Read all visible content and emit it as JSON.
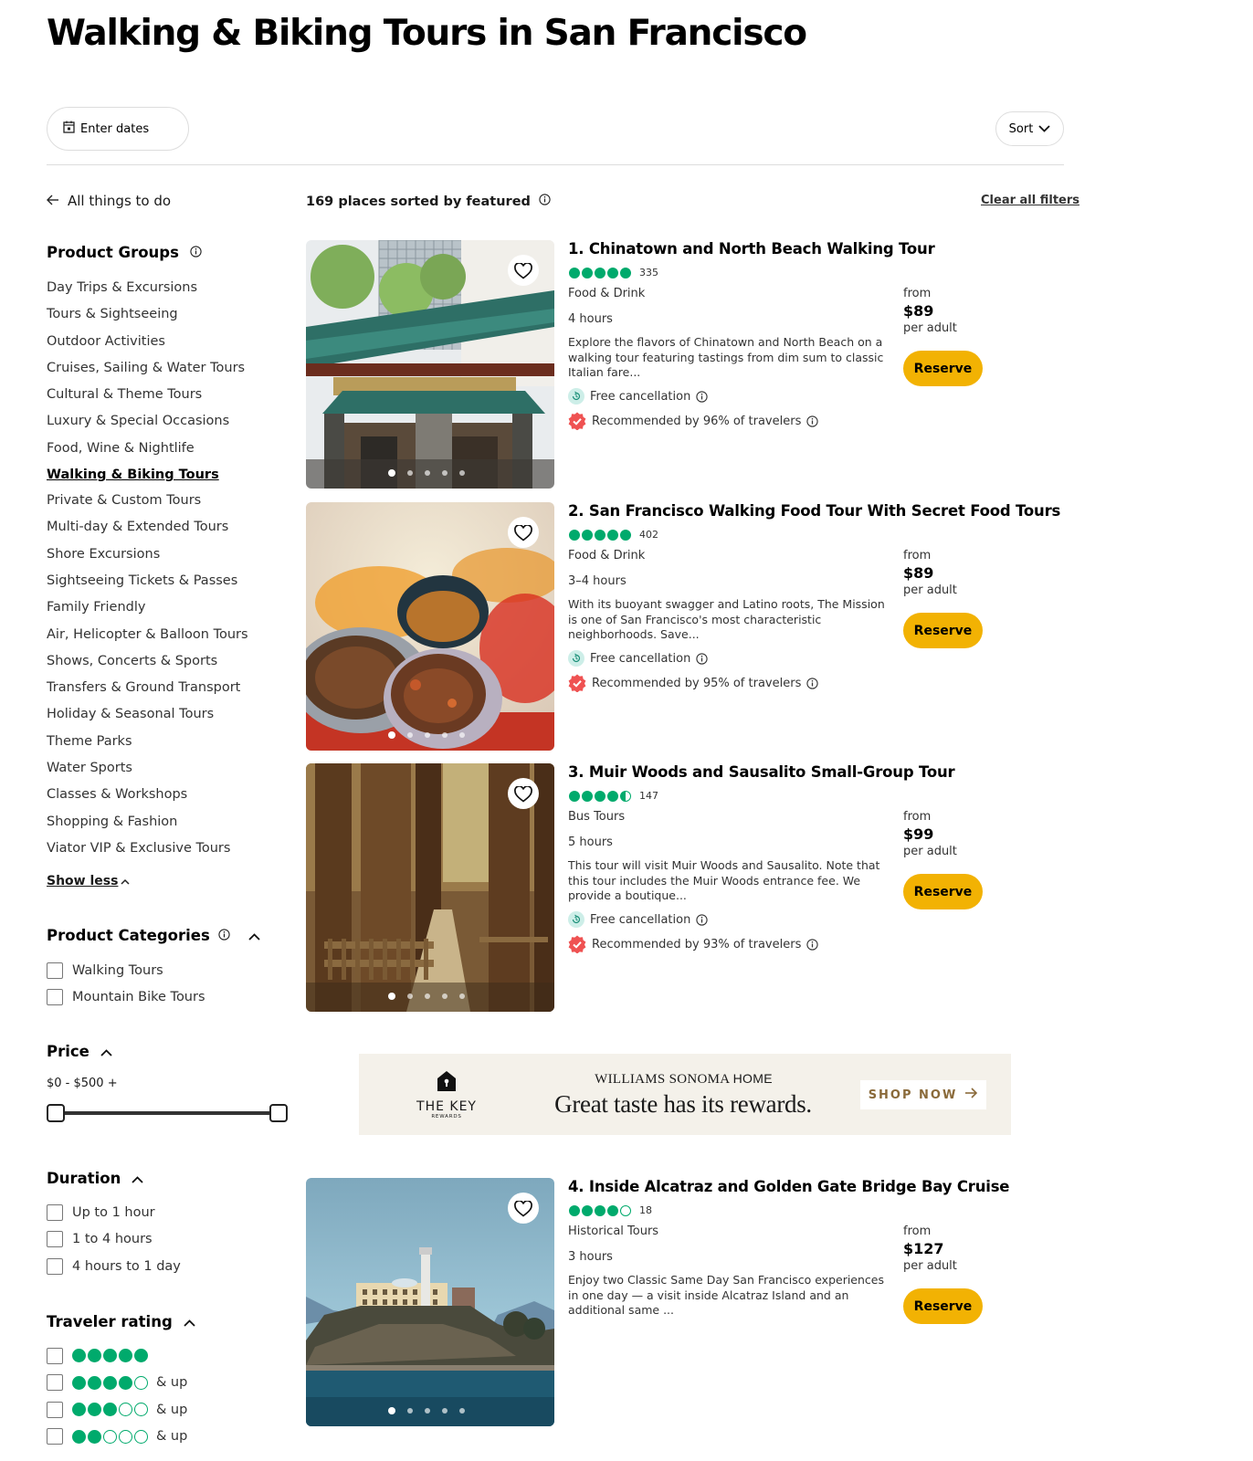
{
  "page": {
    "title": "Walking & Biking Tours in San Francisco"
  },
  "toolbar": {
    "dates_label": "Enter dates",
    "sort_label": "Sort"
  },
  "sidebar": {
    "back_label": "All things to do",
    "product_groups": {
      "heading": "Product Groups",
      "items": [
        {
          "label": "Day Trips & Excursions",
          "active": false
        },
        {
          "label": "Tours & Sightseeing",
          "active": false
        },
        {
          "label": "Outdoor Activities",
          "active": false
        },
        {
          "label": "Cruises, Sailing & Water Tours",
          "active": false
        },
        {
          "label": "Cultural & Theme Tours",
          "active": false
        },
        {
          "label": "Luxury & Special Occasions",
          "active": false
        },
        {
          "label": "Food, Wine & Nightlife",
          "active": false
        },
        {
          "label": "Walking & Biking Tours",
          "active": true
        },
        {
          "label": "Private & Custom Tours",
          "active": false
        },
        {
          "label": "Multi-day & Extended Tours",
          "active": false
        },
        {
          "label": "Shore Excursions",
          "active": false
        },
        {
          "label": "Sightseeing Tickets & Passes",
          "active": false
        },
        {
          "label": "Family Friendly",
          "active": false
        },
        {
          "label": "Air, Helicopter & Balloon Tours",
          "active": false
        },
        {
          "label": "Shows, Concerts & Sports",
          "active": false
        },
        {
          "label": "Transfers & Ground Transport",
          "active": false
        },
        {
          "label": "Holiday & Seasonal Tours",
          "active": false
        },
        {
          "label": "Theme Parks",
          "active": false
        },
        {
          "label": "Water Sports",
          "active": false
        },
        {
          "label": "Classes & Workshops",
          "active": false
        },
        {
          "label": "Shopping & Fashion",
          "active": false
        },
        {
          "label": "Viator VIP & Exclusive Tours",
          "active": false
        }
      ],
      "show_less_label": "Show less"
    },
    "product_categories": {
      "heading": "Product Categories",
      "options": [
        {
          "label": "Walking Tours",
          "checked": false
        },
        {
          "label": "Mountain Bike Tours",
          "checked": false
        }
      ]
    },
    "price": {
      "heading": "Price",
      "range_label": "$0 - $500 +",
      "min_value": 0,
      "max_value": 500
    },
    "duration": {
      "heading": "Duration",
      "options": [
        {
          "label": "Up to 1 hour",
          "checked": false
        },
        {
          "label": "1 to 4 hours",
          "checked": false
        },
        {
          "label": "4 hours to 1 day",
          "checked": false
        }
      ]
    },
    "traveler_rating": {
      "heading": "Traveler rating",
      "options": [
        {
          "rating": 5,
          "suffix": "",
          "checked": false
        },
        {
          "rating": 4,
          "suffix": "& up",
          "checked": false
        },
        {
          "rating": 3,
          "suffix": "& up",
          "checked": false
        },
        {
          "rating": 2,
          "suffix": "& up",
          "checked": false
        }
      ]
    }
  },
  "results": {
    "count_label": "169 places sorted by featured",
    "clear_label": "Clear all filters",
    "items": [
      {
        "title": "1. Chinatown and North Beach Walking Tour",
        "rating": 5,
        "review_count": "335",
        "category": "Food & Drink",
        "duration": "4 hours",
        "description": "Explore the flavors of Chinatown and North Beach on a walking tour featuring tastings from dim sum to classic Italian fare...",
        "free_cancellation": "Free cancellation",
        "recommended": "Recommended by 96% of travelers",
        "from_label": "from",
        "price": "$89",
        "per_label": "per adult",
        "reserve_label": "Reserve",
        "photo": "chinatown-gate",
        "active_dot": 0,
        "dot_count": 5
      },
      {
        "title": "2. San Francisco Walking Food Tour With Secret Food Tours",
        "rating": 5,
        "review_count": "402",
        "category": "Food & Drink",
        "duration": "3–4 hours",
        "description": "With its buoyant swagger and Latino roots, The Mission is one of San Francisco's most characteristic neighborhoods. Save...",
        "free_cancellation": "Free cancellation",
        "recommended": "Recommended by 95% of travelers",
        "from_label": "from",
        "price": "$89",
        "per_label": "per adult",
        "reserve_label": "Reserve",
        "photo": "burrito",
        "active_dot": 0,
        "dot_count": 5
      },
      {
        "title": "3. Muir Woods and Sausalito Small-Group Tour",
        "rating": 4.5,
        "review_count": "147",
        "category": "Bus Tours",
        "duration": "5 hours",
        "description": "This tour will visit Muir Woods and Sausalito. Note that this tour includes the Muir Woods entrance fee. We provide a boutique...",
        "free_cancellation": "Free cancellation",
        "recommended": "Recommended by 93% of travelers",
        "from_label": "from",
        "price": "$99",
        "per_label": "per adult",
        "reserve_label": "Reserve",
        "photo": "redwoods",
        "active_dot": 0,
        "dot_count": 5
      },
      {
        "title": "4. Inside Alcatraz and Golden Gate Bridge Bay Cruise",
        "rating": 4,
        "review_count": "18",
        "category": "Historical Tours",
        "duration": "3 hours",
        "description": "Enjoy two Classic Same Day San Francisco experiences in one day — a visit inside Alcatraz Island and an additional same ...",
        "free_cancellation": "",
        "recommended": "",
        "from_label": "from",
        "price": "$127",
        "per_label": "per adult",
        "reserve_label": "Reserve",
        "photo": "alcatraz",
        "active_dot": 0,
        "dot_count": 5
      }
    ]
  },
  "ad": {
    "logo_name": "THE KEY",
    "logo_sub": "REWARDS",
    "brand": "WILLIAMS SONOMA",
    "brand_suffix": "HOME",
    "tagline": "Great taste has its rewards.",
    "cta": "SHOP NOW"
  },
  "colors": {
    "bubble_green": "#00aa6c",
    "reserve_yellow": "#f2b203",
    "recommended_red": "#ef5252",
    "cancel_teal": "#cdeee8",
    "ad_bg": "#f4f1ea"
  }
}
